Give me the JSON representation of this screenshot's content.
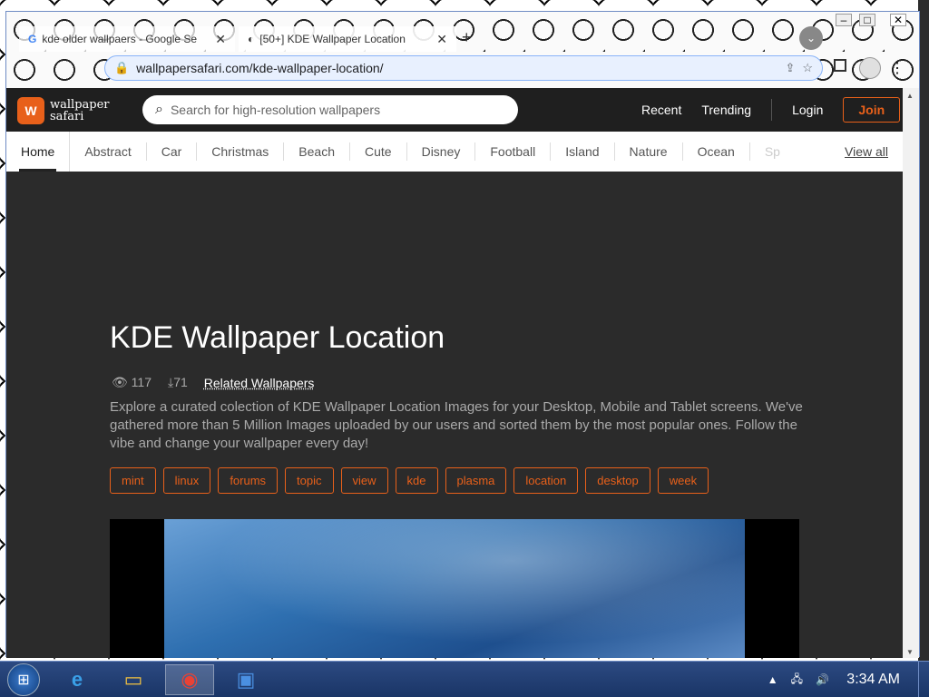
{
  "browser": {
    "tabs": [
      {
        "label": "kde older wallpaers - Google Se",
        "icon": "google-g-icon"
      },
      {
        "label": "[50+] KDE Wallpaper Location",
        "icon": "site-icon"
      }
    ],
    "url": "wallpapersafari.com/kde-wallpaper-location/"
  },
  "site": {
    "logo_line1": "wallpaper",
    "logo_line2": "safari",
    "search_placeholder": "Search for high-resolution wallpapers",
    "nav": {
      "recent": "Recent",
      "trending": "Trending",
      "login": "Login",
      "join": "Join"
    },
    "categories": [
      "Home",
      "Abstract",
      "Car",
      "Christmas",
      "Beach",
      "Cute",
      "Disney",
      "Football",
      "Island",
      "Nature",
      "Ocean",
      "Sp"
    ],
    "view_all": "View all"
  },
  "content": {
    "title": "KDE Wallpaper Location",
    "views": "117",
    "downloads": "71",
    "related": "Related Wallpapers",
    "description": "Explore a curated colection of KDE Wallpaper Location Images for your Desktop, Mobile and Tablet screens. We've gathered more than 5 Million Images uploaded by our users and sorted them by the most popular ones. Follow the vibe and change your wallpaper every day!",
    "tags": [
      "mint",
      "linux",
      "forums",
      "topic",
      "view",
      "kde",
      "plasma",
      "location",
      "desktop",
      "week"
    ]
  },
  "taskbar": {
    "clock": "3:34 AM"
  },
  "colors": {
    "accent": "#e8601a",
    "page_bg": "#2b2b2b",
    "header_bg": "#1f1f1f"
  }
}
